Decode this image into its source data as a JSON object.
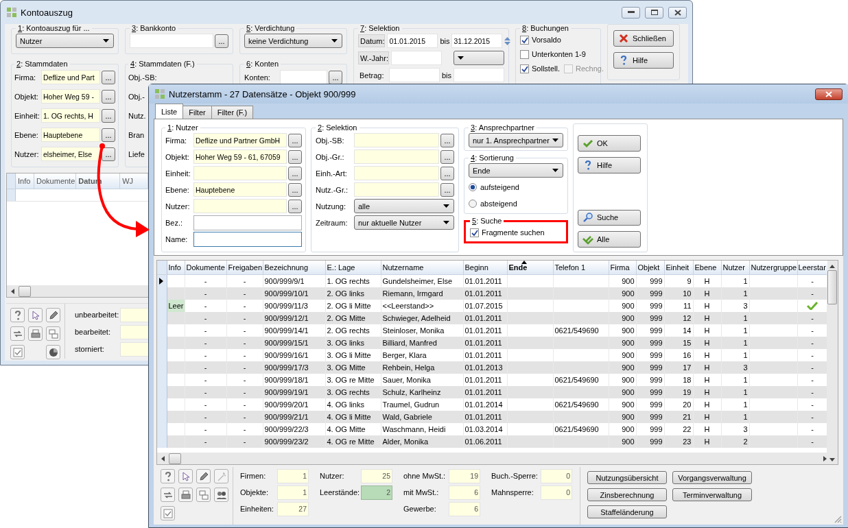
{
  "kontoauszug": {
    "title": "Kontoauszug",
    "kontoauszug_fuer": {
      "label": "1: Kontoauszug für ...",
      "value": "Nutzer"
    },
    "bankkonto": {
      "label": "3: Bankkonto",
      "button": "..."
    },
    "verdichtung": {
      "label": "5: Verdichtung",
      "value": "keine Verdichtung"
    },
    "selektion": {
      "label": "7: Selektion",
      "datum": "Datum:",
      "von": "01.01.2015",
      "bis_label_1": "bis",
      "bis": "31.12.2015",
      "wjahr": "W.-Jahr:",
      "betrag": "Betrag:",
      "bis_label_2": "bis"
    },
    "buchungen": {
      "label": "8: Buchungen",
      "options": [
        {
          "label": "Vorsaldo",
          "checked": true,
          "disabled": false
        },
        {
          "label": "Unterkonten 1-9",
          "checked": false,
          "disabled": false
        },
        {
          "label": "Sollstell.",
          "checked": true,
          "disabled": false
        },
        {
          "label": "Rechng.",
          "checked": false,
          "disabled": true
        }
      ]
    },
    "buttons": [
      {
        "label": "Schließen",
        "kind": "close"
      },
      {
        "label": "Hilfe",
        "kind": "help"
      }
    ],
    "stammdaten": {
      "label": "2: Stammdaten",
      "fields": [
        {
          "label": "Firma:",
          "value": "Deflize und Part",
          "button": "..."
        },
        {
          "label": "Objekt:",
          "value": "Hoher Weg 59 -",
          "button": "..."
        },
        {
          "label": "Einheit:",
          "value": "1. OG rechts, H",
          "button": "..."
        },
        {
          "label": "Ebene:",
          "value": "Hauptebene",
          "button": "..."
        },
        {
          "label": "Nutzer:",
          "value": "elsheimer, Else",
          "button": "..."
        }
      ]
    },
    "stammdaten_f": {
      "label": "4: Stammdaten (F.)",
      "fields": [
        "Obj.-SB:",
        "Obj.-",
        "Nutz.",
        "Bran",
        "Liefe"
      ]
    },
    "konten": {
      "label": "6: Konten",
      "field_label": "Konten:",
      "button": "..."
    },
    "table": {
      "columns": [
        {
          "label": "Info",
          "sorted": false
        },
        {
          "label": "Dokumente",
          "sorted": false
        },
        {
          "label": "Datum",
          "sorted": true
        },
        {
          "label": "WJ",
          "sorted": false
        }
      ]
    },
    "status": [
      "unbearbeitet:",
      "bearbeitet:",
      "storniert:"
    ]
  },
  "nutzerstamm": {
    "title": "Nutzerstamm - 27 Datensätze - Objekt 900/999",
    "tabs": [
      {
        "label": "Liste",
        "selected": true
      },
      {
        "label": "Filter",
        "selected": false
      },
      {
        "label": "Filter (F.)",
        "selected": false
      }
    ],
    "nutzer": {
      "label": "1: Nutzer",
      "fields": [
        {
          "label": "Firma:",
          "kind": "lookup",
          "value": "Deflize und Partner GmbH",
          "button": "..."
        },
        {
          "label": "Objekt:",
          "kind": "lookup",
          "value": "Hoher Weg 59 - 61, 67059",
          "button": "..."
        },
        {
          "label": "Einheit:",
          "kind": "lookup",
          "button": "..."
        },
        {
          "label": "Ebene:",
          "kind": "lookup",
          "value": "Hauptebene",
          "button": "..."
        },
        {
          "label": "Nutzer:",
          "kind": "lookup",
          "button": "..."
        },
        {
          "label": "Bez.:",
          "kind": "text",
          "focused": false
        },
        {
          "label": "Name:",
          "kind": "text",
          "focused": true
        }
      ]
    },
    "selektion": {
      "label": "2: Selektion",
      "fields": [
        {
          "label": "Obj.-SB:",
          "kind": "lookup",
          "button": "..."
        },
        {
          "label": "Obj.-Gr.:",
          "kind": "lookup",
          "button": "..."
        },
        {
          "label": "Einh.-Art:",
          "kind": "lookup",
          "button": "..."
        },
        {
          "label": "Nutz.-Gr.:",
          "kind": "lookup",
          "button": "..."
        },
        {
          "label": "Nutzung:",
          "kind": "select",
          "value": "alle"
        },
        {
          "label": "Zeitraum:",
          "kind": "select",
          "value": "nur aktuelle Nutzer"
        }
      ]
    },
    "ansprechpartner": {
      "label": "3: Ansprechpartner",
      "value": "nur 1. Ansprechpartner"
    },
    "sortierung": {
      "label": "4: Sortierung",
      "value": "Ende",
      "options": [
        {
          "label": "aufsteigend",
          "selected": true
        },
        {
          "label": "absteigend",
          "selected": false
        }
      ]
    },
    "suche": {
      "label": "5: Suche",
      "highlighted": true,
      "option": {
        "label": "Fragmente suchen",
        "checked": true
      }
    },
    "buttons": [
      {
        "label": "OK",
        "kind": "ok"
      },
      {
        "label": "Hilfe",
        "kind": "help"
      },
      {
        "label": "Suche",
        "kind": "search"
      },
      {
        "label": "Alle",
        "kind": "all"
      }
    ],
    "table": {
      "columns": [
        {
          "label": "Info",
          "sorted": false
        },
        {
          "label": "Dokumente",
          "sorted": false
        },
        {
          "label": "Freigaben",
          "sorted": false
        },
        {
          "label": "Bezeichnung",
          "sorted": false
        },
        {
          "label": "E.: Lage",
          "sorted": false
        },
        {
          "label": "Nutzername",
          "sorted": false
        },
        {
          "label": "Beginn",
          "sorted": false
        },
        {
          "label": "Ende",
          "sorted": true
        },
        {
          "label": "Telefon 1",
          "sorted": false
        },
        {
          "label": "Firma",
          "sorted": false
        },
        {
          "label": "Objekt",
          "sorted": false
        },
        {
          "label": "Einheit",
          "sorted": false
        },
        {
          "label": "Ebene",
          "sorted": false
        },
        {
          "label": "Nutzer",
          "sorted": false
        },
        {
          "label": "Nutzergruppe",
          "sorted": false
        },
        {
          "label": "Leerstar",
          "sorted": false
        }
      ],
      "rows": [
        {
          "selected": true,
          "dokumente": "-",
          "freigaben": "-",
          "bezeichnung": "900/999/9/1",
          "lage": "1. OG rechts",
          "nutzername": "Gundelsheimer, Else",
          "beginn": "01.01.2011",
          "firma": "900",
          "objekt": "999",
          "einheit": "9",
          "ebene": "H",
          "nutzer": "1",
          "vacant": false,
          "leerstand": "-"
        },
        {
          "selected": false,
          "dokumente": "-",
          "freigaben": "-",
          "bezeichnung": "900/999/10/1",
          "lage": "2. OG links",
          "nutzername": "Riemann, Irmgard",
          "beginn": "01.01.2011",
          "firma": "900",
          "objekt": "999",
          "einheit": "10",
          "ebene": "H",
          "nutzer": "1",
          "vacant": false,
          "leerstand": "-"
        },
        {
          "selected": false,
          "info": "Leer",
          "dokumente": "-",
          "freigaben": "-",
          "bezeichnung": "900/999/11/3",
          "lage": "2. OG li Mitte",
          "nutzername": "<<Leerstand>>",
          "beginn": "01.07.2015",
          "firma": "900",
          "objekt": "999",
          "einheit": "11",
          "ebene": "H",
          "nutzer": "3",
          "vacant": true
        },
        {
          "selected": false,
          "dokumente": "-",
          "freigaben": "-",
          "bezeichnung": "900/999/12/1",
          "lage": "2. OG Mitte",
          "nutzername": "Schwieger, Adelheid",
          "beginn": "01.01.2011",
          "firma": "900",
          "objekt": "999",
          "einheit": "12",
          "ebene": "H",
          "nutzer": "1",
          "vacant": false,
          "leerstand": "-"
        },
        {
          "selected": false,
          "dokumente": "-",
          "freigaben": "-",
          "bezeichnung": "900/999/14/1",
          "lage": "2. OG rechts",
          "nutzername": "Steinloser, Monika",
          "beginn": "01.01.2011",
          "telefon": "0621/549690",
          "firma": "900",
          "objekt": "999",
          "einheit": "14",
          "ebene": "H",
          "nutzer": "1",
          "vacant": false,
          "leerstand": "-"
        },
        {
          "selected": false,
          "dokumente": "-",
          "freigaben": "-",
          "bezeichnung": "900/999/15/1",
          "lage": "3. OG links",
          "nutzername": "Billiard, Manfred",
          "beginn": "01.01.2011",
          "firma": "900",
          "objekt": "999",
          "einheit": "15",
          "ebene": "H",
          "nutzer": "1",
          "vacant": false,
          "leerstand": "-"
        },
        {
          "selected": false,
          "dokumente": "-",
          "freigaben": "-",
          "bezeichnung": "900/999/16/1",
          "lage": "3. OG li Mitte",
          "nutzername": "Berger, Klara",
          "beginn": "01.01.2011",
          "firma": "900",
          "objekt": "999",
          "einheit": "16",
          "ebene": "H",
          "nutzer": "1",
          "vacant": false,
          "leerstand": "-"
        },
        {
          "selected": false,
          "dokumente": "-",
          "freigaben": "-",
          "bezeichnung": "900/999/17/3",
          "lage": "3. OG Mitte",
          "nutzername": "Rehbein, Helga",
          "beginn": "01.01.2013",
          "firma": "900",
          "objekt": "999",
          "einheit": "17",
          "ebene": "H",
          "nutzer": "3",
          "vacant": false,
          "leerstand": "-"
        },
        {
          "selected": false,
          "dokumente": "-",
          "freigaben": "-",
          "bezeichnung": "900/999/18/1",
          "lage": "3. OG re Mitte",
          "nutzername": "Sauer, Monika",
          "beginn": "01.01.2011",
          "telefon": "0621/549690",
          "firma": "900",
          "objekt": "999",
          "einheit": "18",
          "ebene": "H",
          "nutzer": "1",
          "vacant": false,
          "leerstand": "-"
        },
        {
          "selected": false,
          "dokumente": "-",
          "freigaben": "-",
          "bezeichnung": "900/999/19/1",
          "lage": "3. OG rechts",
          "nutzername": "Schulz, Karlheinz",
          "beginn": "01.01.2011",
          "firma": "900",
          "objekt": "999",
          "einheit": "19",
          "ebene": "H",
          "nutzer": "1",
          "vacant": false,
          "leerstand": "-"
        },
        {
          "selected": false,
          "dokumente": "-",
          "freigaben": "-",
          "bezeichnung": "900/999/20/1",
          "lage": "4. OG links",
          "nutzername": "Traumel, Gudrun",
          "beginn": "01.01.2014",
          "telefon": "0621/549690",
          "firma": "900",
          "objekt": "999",
          "einheit": "20",
          "ebene": "H",
          "nutzer": "1",
          "vacant": false,
          "leerstand": "-"
        },
        {
          "selected": false,
          "dokumente": "-",
          "freigaben": "-",
          "bezeichnung": "900/999/21/1",
          "lage": "4. OG li Mitte",
          "nutzername": "Wald, Gabriele",
          "beginn": "01.01.2011",
          "firma": "900",
          "objekt": "999",
          "einheit": "21",
          "ebene": "H",
          "nutzer": "1",
          "vacant": false,
          "leerstand": "-"
        },
        {
          "selected": false,
          "dokumente": "-",
          "freigaben": "-",
          "bezeichnung": "900/999/22/3",
          "lage": "4. OG Mitte",
          "nutzername": "Waschmann, Heidi",
          "beginn": "01.03.2014",
          "telefon": "0621/549690",
          "firma": "900",
          "objekt": "999",
          "einheit": "22",
          "ebene": "H",
          "nutzer": "3",
          "vacant": false,
          "leerstand": "-"
        },
        {
          "selected": false,
          "dokumente": "-",
          "freigaben": "-",
          "bezeichnung": "900/999/23/2",
          "lage": "4. OG re Mitte",
          "nutzername": "Alder, Monika",
          "beginn": "01.06.2011",
          "firma": "900",
          "objekt": "999",
          "einheit": "23",
          "ebene": "H",
          "nutzer": "2",
          "vacant": false,
          "leerstand": "-"
        }
      ]
    },
    "stats": [
      [
        {
          "label": "Firmen:",
          "value": "1",
          "highlighted": false
        },
        {
          "label": "Objekte:",
          "value": "1",
          "highlighted": false
        },
        {
          "label": "Einheiten:",
          "value": "27",
          "highlighted": false
        }
      ],
      [
        {
          "label": "Nutzer:",
          "value": "25",
          "highlighted": false
        },
        {
          "label": "Leerstände:",
          "value": "2",
          "highlighted": true
        }
      ],
      [
        {
          "label": "ohne MwSt.:",
          "value": "19",
          "highlighted": false
        },
        {
          "label": "mit MwSt.:",
          "value": "6",
          "highlighted": false
        },
        {
          "label": "Gewerbe:",
          "value": "6",
          "highlighted": false
        }
      ],
      [
        {
          "label": "Buch.-Sperre:",
          "value": "0",
          "highlighted": false
        },
        {
          "label": "Mahnsperre:",
          "value": "0",
          "highlighted": false
        }
      ]
    ],
    "footer_buttons": [
      "Nutzungsübersicht",
      "Vorgangsverwaltung",
      "Zinsberechnung",
      "Terminverwaltung",
      "Staffeländerung"
    ]
  }
}
